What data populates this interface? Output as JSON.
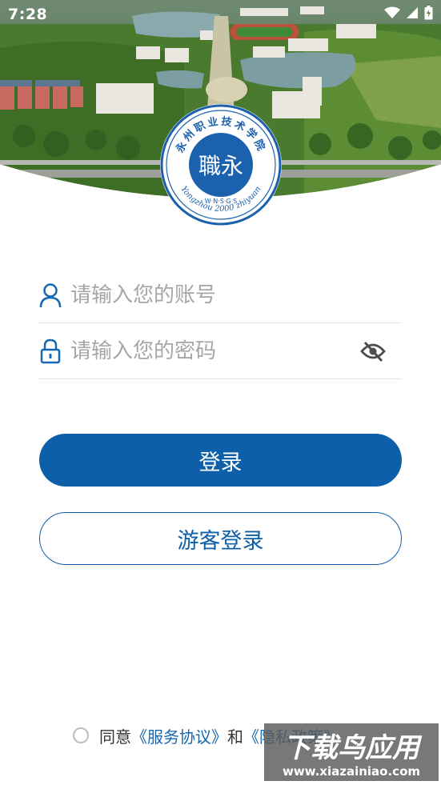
{
  "status_bar": {
    "time": "7:28",
    "icons": [
      "wifi-icon",
      "signal-icon",
      "battery-charging-icon"
    ]
  },
  "logo": {
    "top_text": "永州职业技术学院",
    "center_glyph": "職永",
    "abbr": "W·N·S·G·S",
    "bottom_text": "Yongzhou 2000 zhiyuan"
  },
  "login": {
    "account_placeholder": "请输入您的账号",
    "password_placeholder": "请输入您的密码",
    "login_button": "登录",
    "guest_button": "游客登录"
  },
  "agreement": {
    "prefix": "同意",
    "service_link": "《服务协议》",
    "conjunction": "和",
    "privacy_link": "《隐私政策》"
  },
  "watermark": {
    "title": "下载鸟应用",
    "url": "www.xiazainiao.com"
  },
  "colors": {
    "primary": "#0d5faa",
    "link": "#1467b0",
    "placeholder": "#a6a6a6"
  }
}
